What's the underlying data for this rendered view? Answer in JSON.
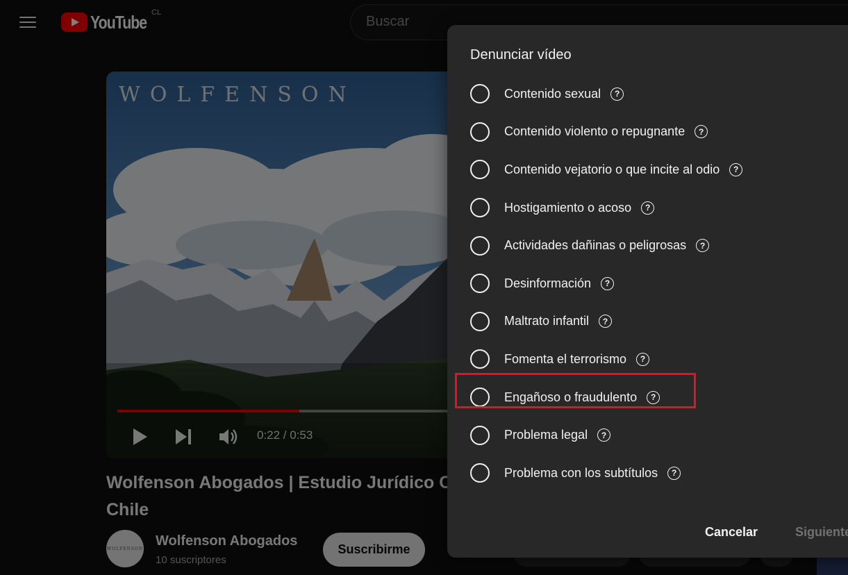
{
  "masthead": {
    "logo_text": "YouTube",
    "country_code": "CL",
    "search_placeholder": "Buscar"
  },
  "player": {
    "wordmark": "WOLFENSON",
    "progress_fraction": 0.52,
    "current_time": "0:22",
    "duration": "0:53",
    "time_display": "0:22 / 0:53"
  },
  "video": {
    "title": "Wolfenson Abogados | Estudio Jurídico C\nChile",
    "title_line1": "Wolfenson Abogados | Estudio Jurídico C",
    "title_line2": "Chile"
  },
  "channel": {
    "avatar_text": "WOLFENSON",
    "name": "Wolfenson Abogados",
    "subscribers": "10 suscriptores",
    "subscribe_label": "Suscribirme"
  },
  "report_dialog": {
    "title": "Denunciar vídeo",
    "options": [
      {
        "label": "Contenido sexual"
      },
      {
        "label": "Contenido violento o repugnante"
      },
      {
        "label": "Contenido vejatorio o que incite al odio"
      },
      {
        "label": "Hostigamiento o acoso"
      },
      {
        "label": "Actividades dañinas o peligrosas"
      },
      {
        "label": "Desinformación"
      },
      {
        "label": "Maltrato infantil"
      },
      {
        "label": "Fomenta el terrorismo"
      },
      {
        "label": "Engañoso o fraudulento"
      },
      {
        "label": "Problema legal"
      },
      {
        "label": "Problema con los subtítulos"
      }
    ],
    "highlighted_option": "Engañoso o fraudulento",
    "cancel_label": "Cancelar",
    "next_label": "Siguiente"
  },
  "colors": {
    "background": "#0f0f0f",
    "dialog": "#282828",
    "brand_red": "#ff0000",
    "highlight_border": "#e5131b"
  }
}
